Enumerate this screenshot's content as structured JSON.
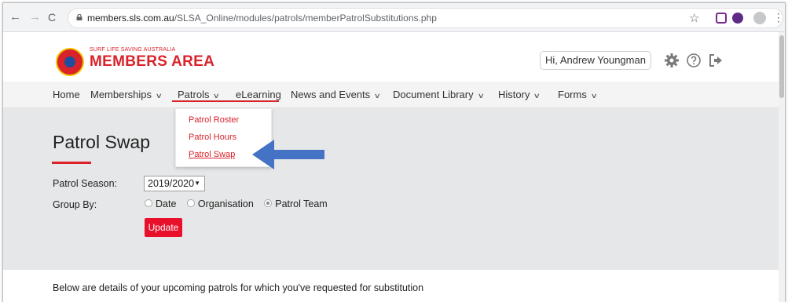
{
  "browser": {
    "back_glyph": "←",
    "forward_glyph": "→",
    "reload_glyph": "C",
    "url_host": "members.sls.com.au",
    "url_path": "/SLSA_Online/modules/patrols/memberPatrolSubstitutions.php",
    "star_glyph": "☆",
    "menu_glyph": "⋮"
  },
  "header": {
    "logo_small": "SURF LIFE SAVING AUSTRALIA",
    "logo_big": "MEMBERS AREA",
    "greeting": "Hi, Andrew Youngman",
    "icons": [
      "gear-icon",
      "help-icon",
      "sign-out-icon"
    ]
  },
  "nav": {
    "items": [
      {
        "label": "Home",
        "dropdown": false
      },
      {
        "label": "Memberships",
        "dropdown": true
      },
      {
        "label": "Patrols",
        "dropdown": true
      },
      {
        "label": "eLearning",
        "dropdown": false
      },
      {
        "label": "News and Events",
        "dropdown": true
      },
      {
        "label": "Document Library",
        "dropdown": true
      },
      {
        "label": "History",
        "dropdown": true
      },
      {
        "label": "Forms",
        "dropdown": true
      }
    ],
    "chevron": "∨"
  },
  "patrols_menu": {
    "items": [
      "Patrol Roster",
      "Patrol Hours",
      "Patrol Swap"
    ],
    "active": "Patrol Swap"
  },
  "main": {
    "title": "Patrol Swap",
    "season_label": "Patrol Season:",
    "season_value": "2019/2020",
    "select_arrow": "▼",
    "group_by_label": "Group By:",
    "group_options": [
      {
        "label": "Date",
        "checked": false
      },
      {
        "label": "Organisation",
        "checked": false
      },
      {
        "label": "Patrol Team",
        "checked": true
      }
    ],
    "update_label": "Update"
  },
  "bottom_text": "Below are details of your upcoming patrols for which you've requested for substitution",
  "colors": {
    "brand_red": "#d9222a",
    "button_red": "#e8102b",
    "annotation_arrow": "#4472c4",
    "panel_grey": "#e6e7e8"
  }
}
